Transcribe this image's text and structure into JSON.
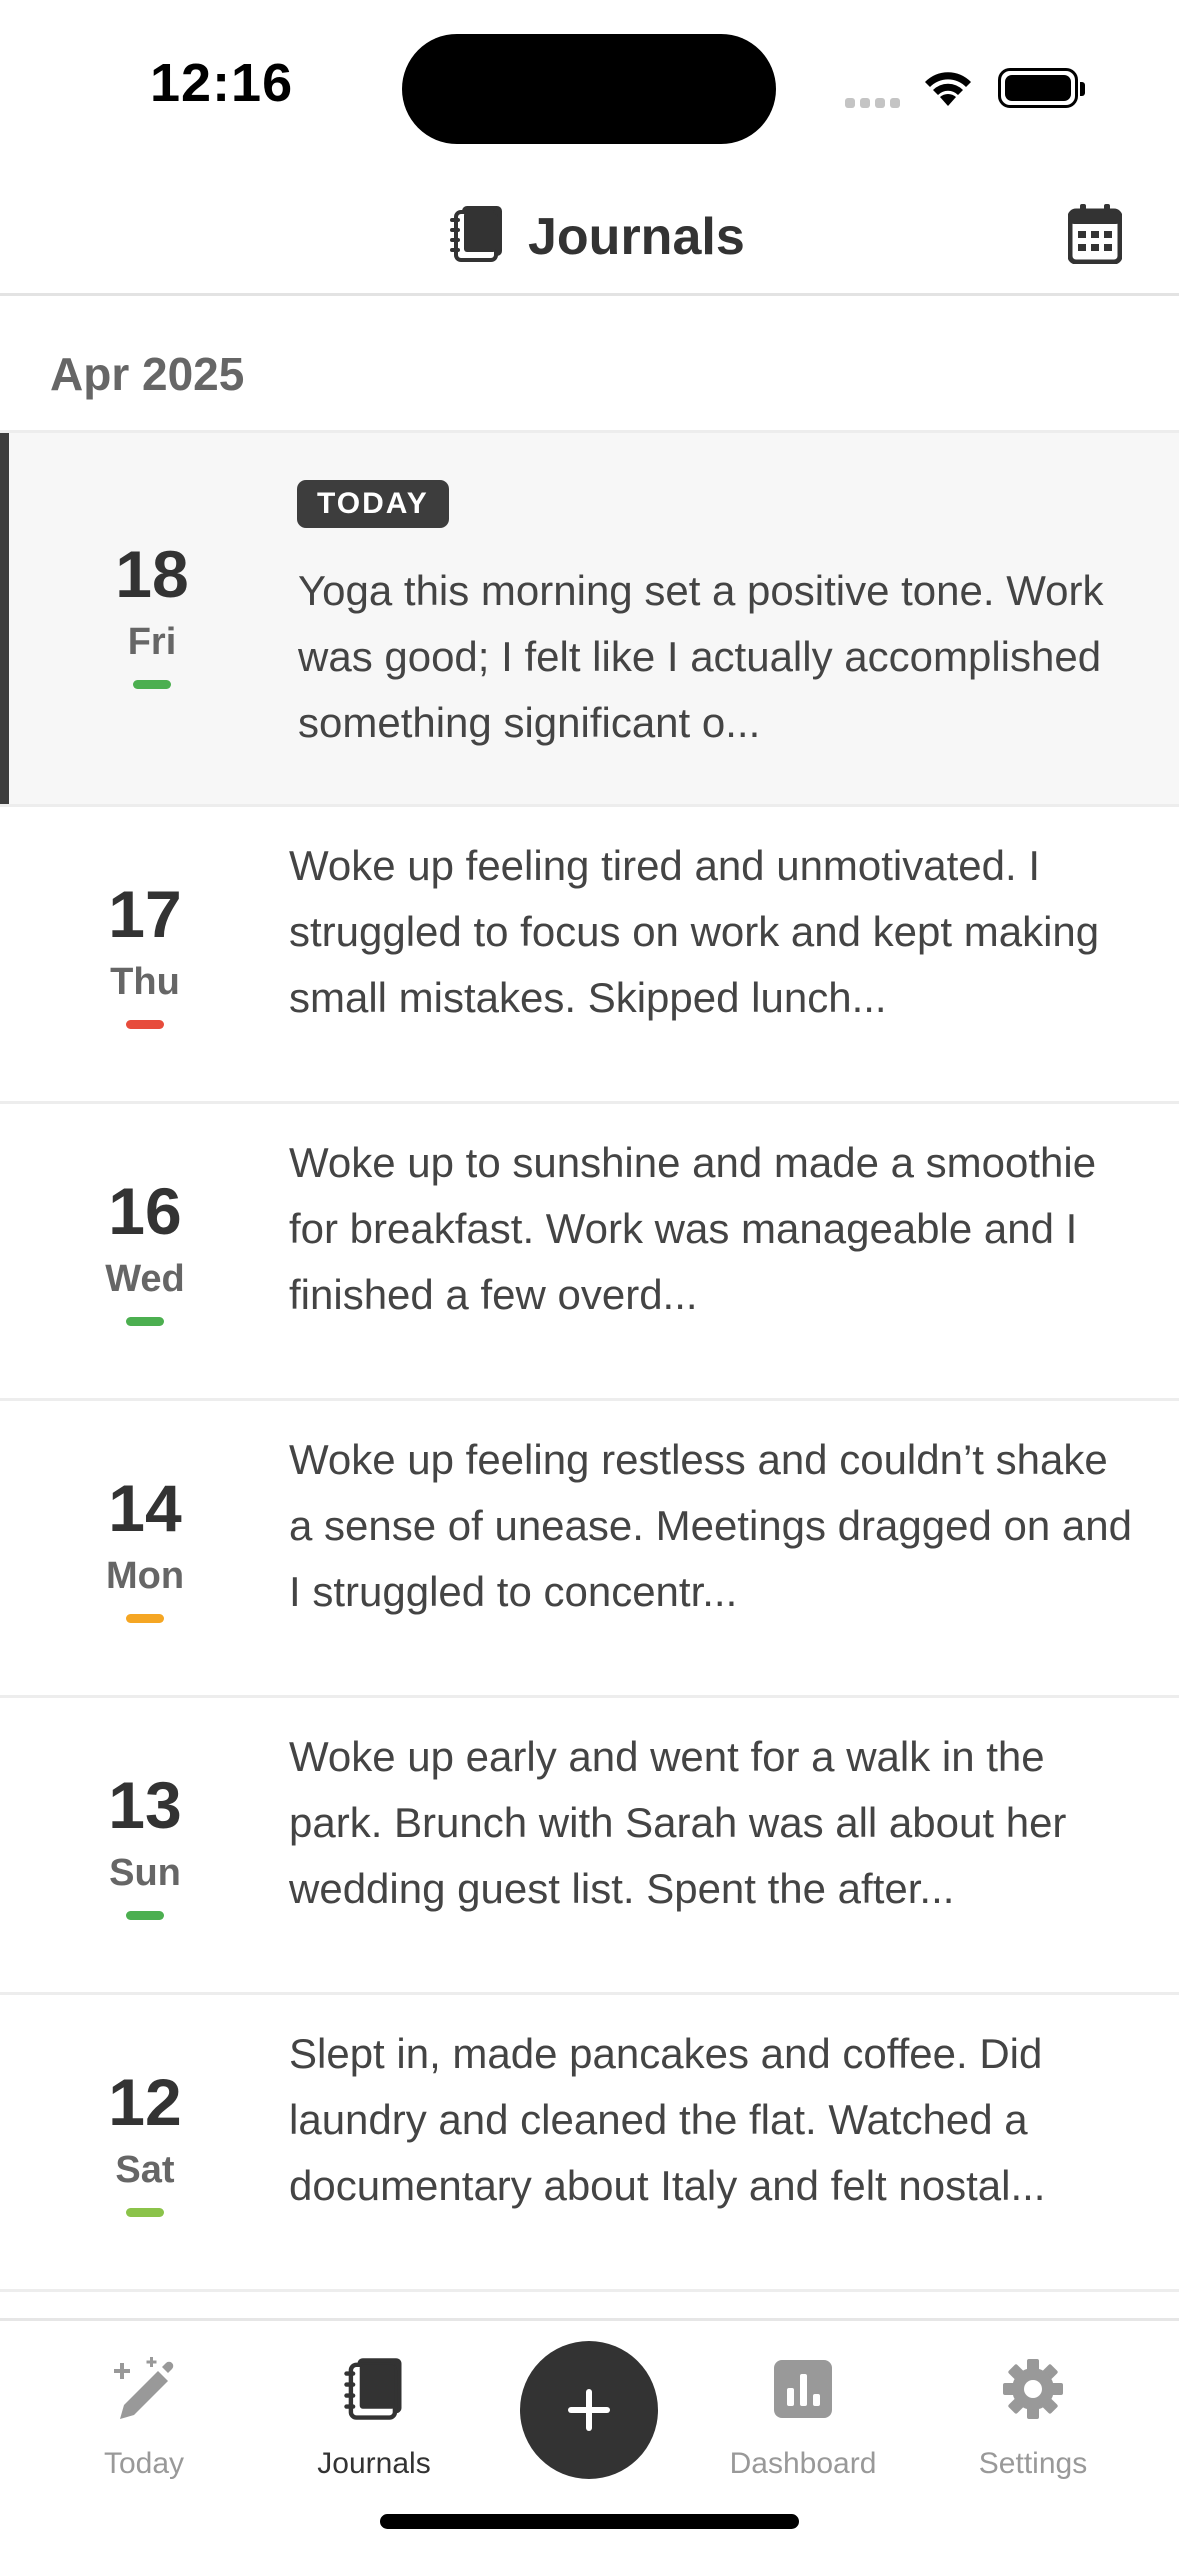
{
  "status_bar": {
    "time": "12:16"
  },
  "header": {
    "title": "Journals",
    "icon": "journals-icon",
    "right_icon": "calendar-icon"
  },
  "month": "Apr 2025",
  "entries": [
    {
      "day": "18",
      "weekday": "Fri",
      "today_badge": "TODAY",
      "mood_color": "#4caf50",
      "text": "Yoga this morning set a positive tone. Work was good; I felt like I actually accomplished something significant o..."
    },
    {
      "day": "17",
      "weekday": "Thu",
      "mood_color": "#e74c3c",
      "text": "Woke up feeling tired and unmotivated. I struggled to focus on work and kept making small mistakes. Skipped lunch..."
    },
    {
      "day": "16",
      "weekday": "Wed",
      "mood_color": "#4caf50",
      "text": "Woke up to sunshine and made a smoothie for breakfast. Work was manageable and I finished a few overd..."
    },
    {
      "day": "14",
      "weekday": "Mon",
      "mood_color": "#f5a623",
      "text": "Woke up feeling restless and couldn’t shake a sense of unease. Meetings dragged on and I struggled to concentr..."
    },
    {
      "day": "13",
      "weekday": "Sun",
      "mood_color": "#4caf50",
      "text": "Woke up early and went for a walk in the park. Brunch with Sarah was all about her wedding guest list. Spent the after..."
    },
    {
      "day": "12",
      "weekday": "Sat",
      "mood_color": "#8bc34a",
      "text": "Slept in, made pancakes and coffee. Did laundry and cleaned the flat. Watched a documentary about Italy and felt nostal..."
    }
  ],
  "tab_bar": {
    "today": "Today",
    "journals": "Journals",
    "dashboard": "Dashboard",
    "settings": "Settings",
    "active": "Journals",
    "fab_icon": "plus-icon"
  }
}
